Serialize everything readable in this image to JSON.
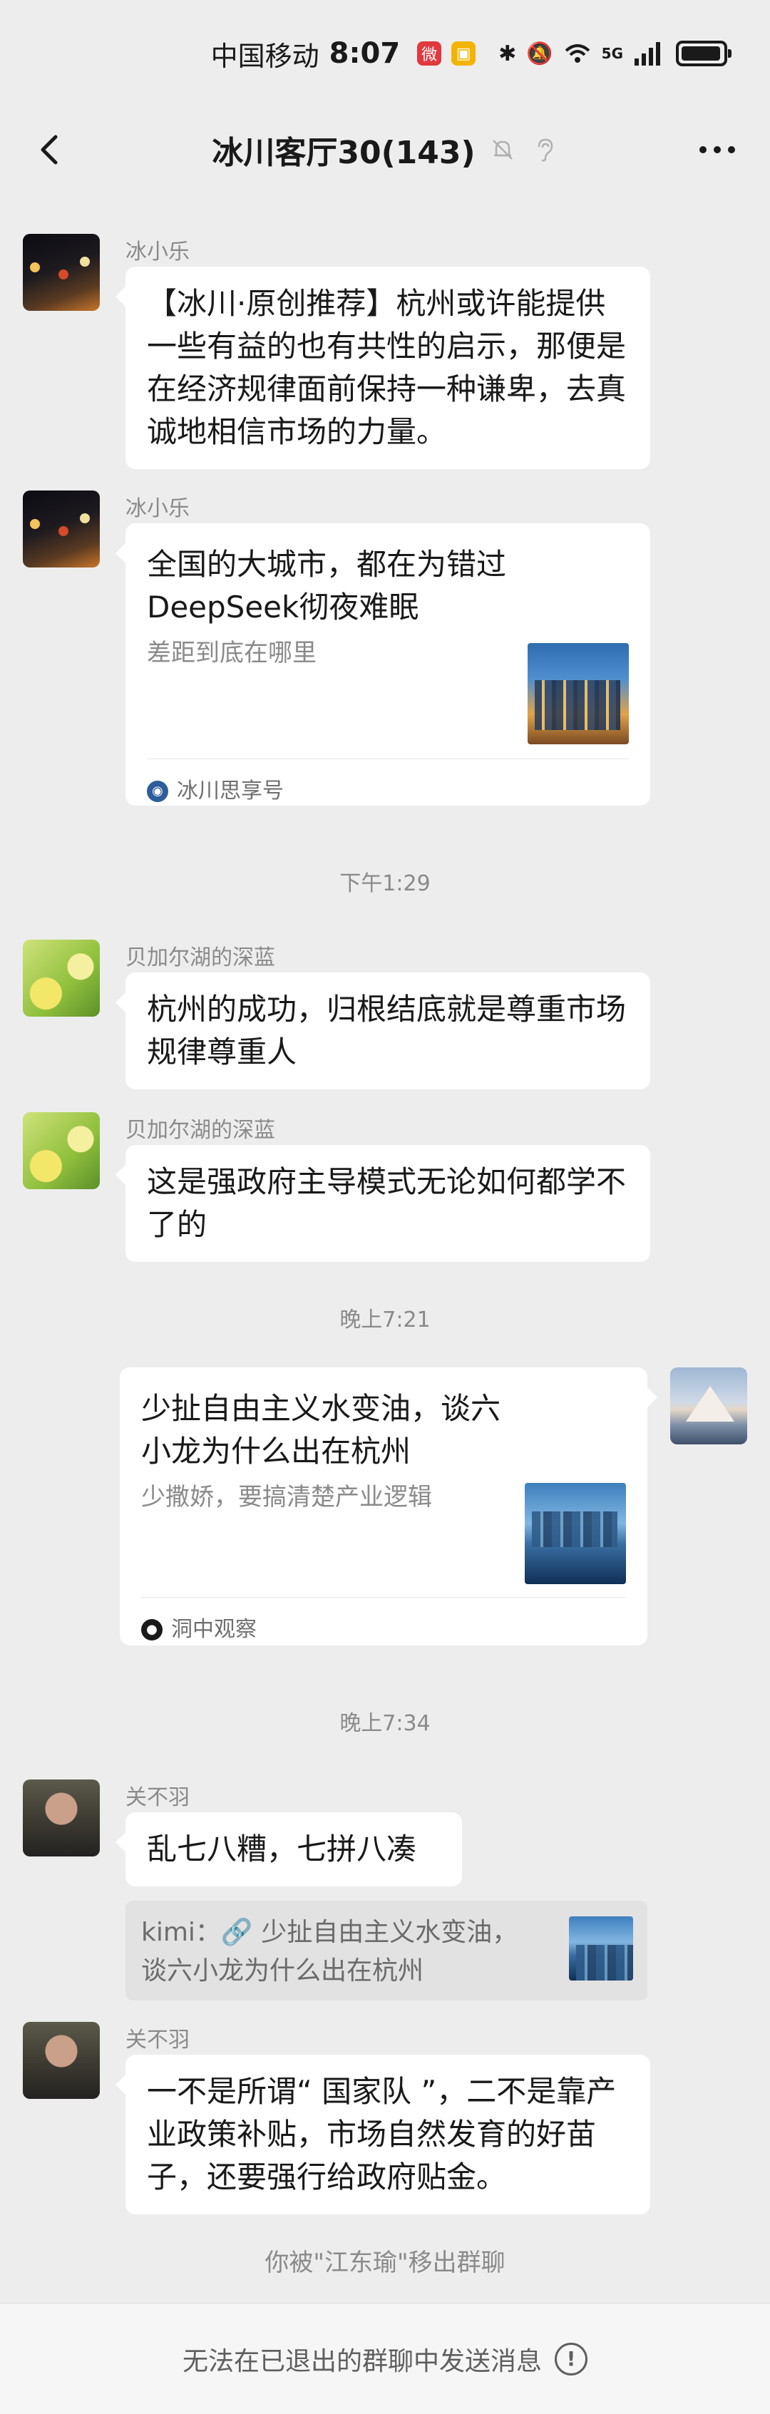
{
  "status_bar": {
    "carrier": "中国移动",
    "time": "8:07",
    "network": "5G",
    "icons": [
      "weibo-icon",
      "app-badge-icon",
      "bluetooth-icon",
      "mute-icon",
      "wifi-icon",
      "signal-icon",
      "battery-icon"
    ]
  },
  "header": {
    "title": "冰川客厅30(143)",
    "icons": [
      "back-icon",
      "mute-bell-icon",
      "ear-icon",
      "more-icon"
    ]
  },
  "messages": [
    {
      "sender": "冰小乐",
      "text": "【冰川·原创推荐】杭州或许能提供一些有益的也有共性的启示，那便是在经济规律面前保持一种谦卑，去真诚地相信市场的力量。"
    },
    {
      "sender": "冰小乐",
      "card": {
        "title": "全国的大城市，都在为错过DeepSeek彻夜难眠",
        "desc": "差距到底在哪里",
        "source": "冰川思享号"
      }
    },
    {
      "timestamp": "下午1:29"
    },
    {
      "sender": "贝加尔湖的深蓝",
      "text": "杭州的成功，归根结底就是尊重市场规律尊重人"
    },
    {
      "sender": "贝加尔湖的深蓝",
      "text": "这是强政府主导模式无论如何都学不了的"
    },
    {
      "timestamp": "晚上7:21"
    },
    {
      "self": true,
      "card": {
        "title": "少扯自由主义水变油，谈六小龙为什么出在杭州",
        "desc": "少撒娇，要搞清楚产业逻辑",
        "source": "洞中观察"
      }
    },
    {
      "timestamp": "晚上7:34"
    },
    {
      "sender": "关不羽",
      "text": "乱七八糟，七拼八凑",
      "quote": "kimi：🔗 少扯自由主义水变油，谈六小龙为什么出在杭州"
    },
    {
      "sender": "关不羽",
      "text": "一不是所谓“ 国家队 ”，二不是靠产业政策补贴，市场自然发育的好苗子，还要强行给政府贴金。"
    }
  ],
  "system_note": "你被\"江东瑜\"移出群聊",
  "bottom": {
    "text": "无法在已退出的群聊中发送消息",
    "icon": "alert-icon"
  },
  "colors": {
    "background": "#ededed",
    "bubble": "#ffffff",
    "muted_text": "#8a8a8a"
  }
}
